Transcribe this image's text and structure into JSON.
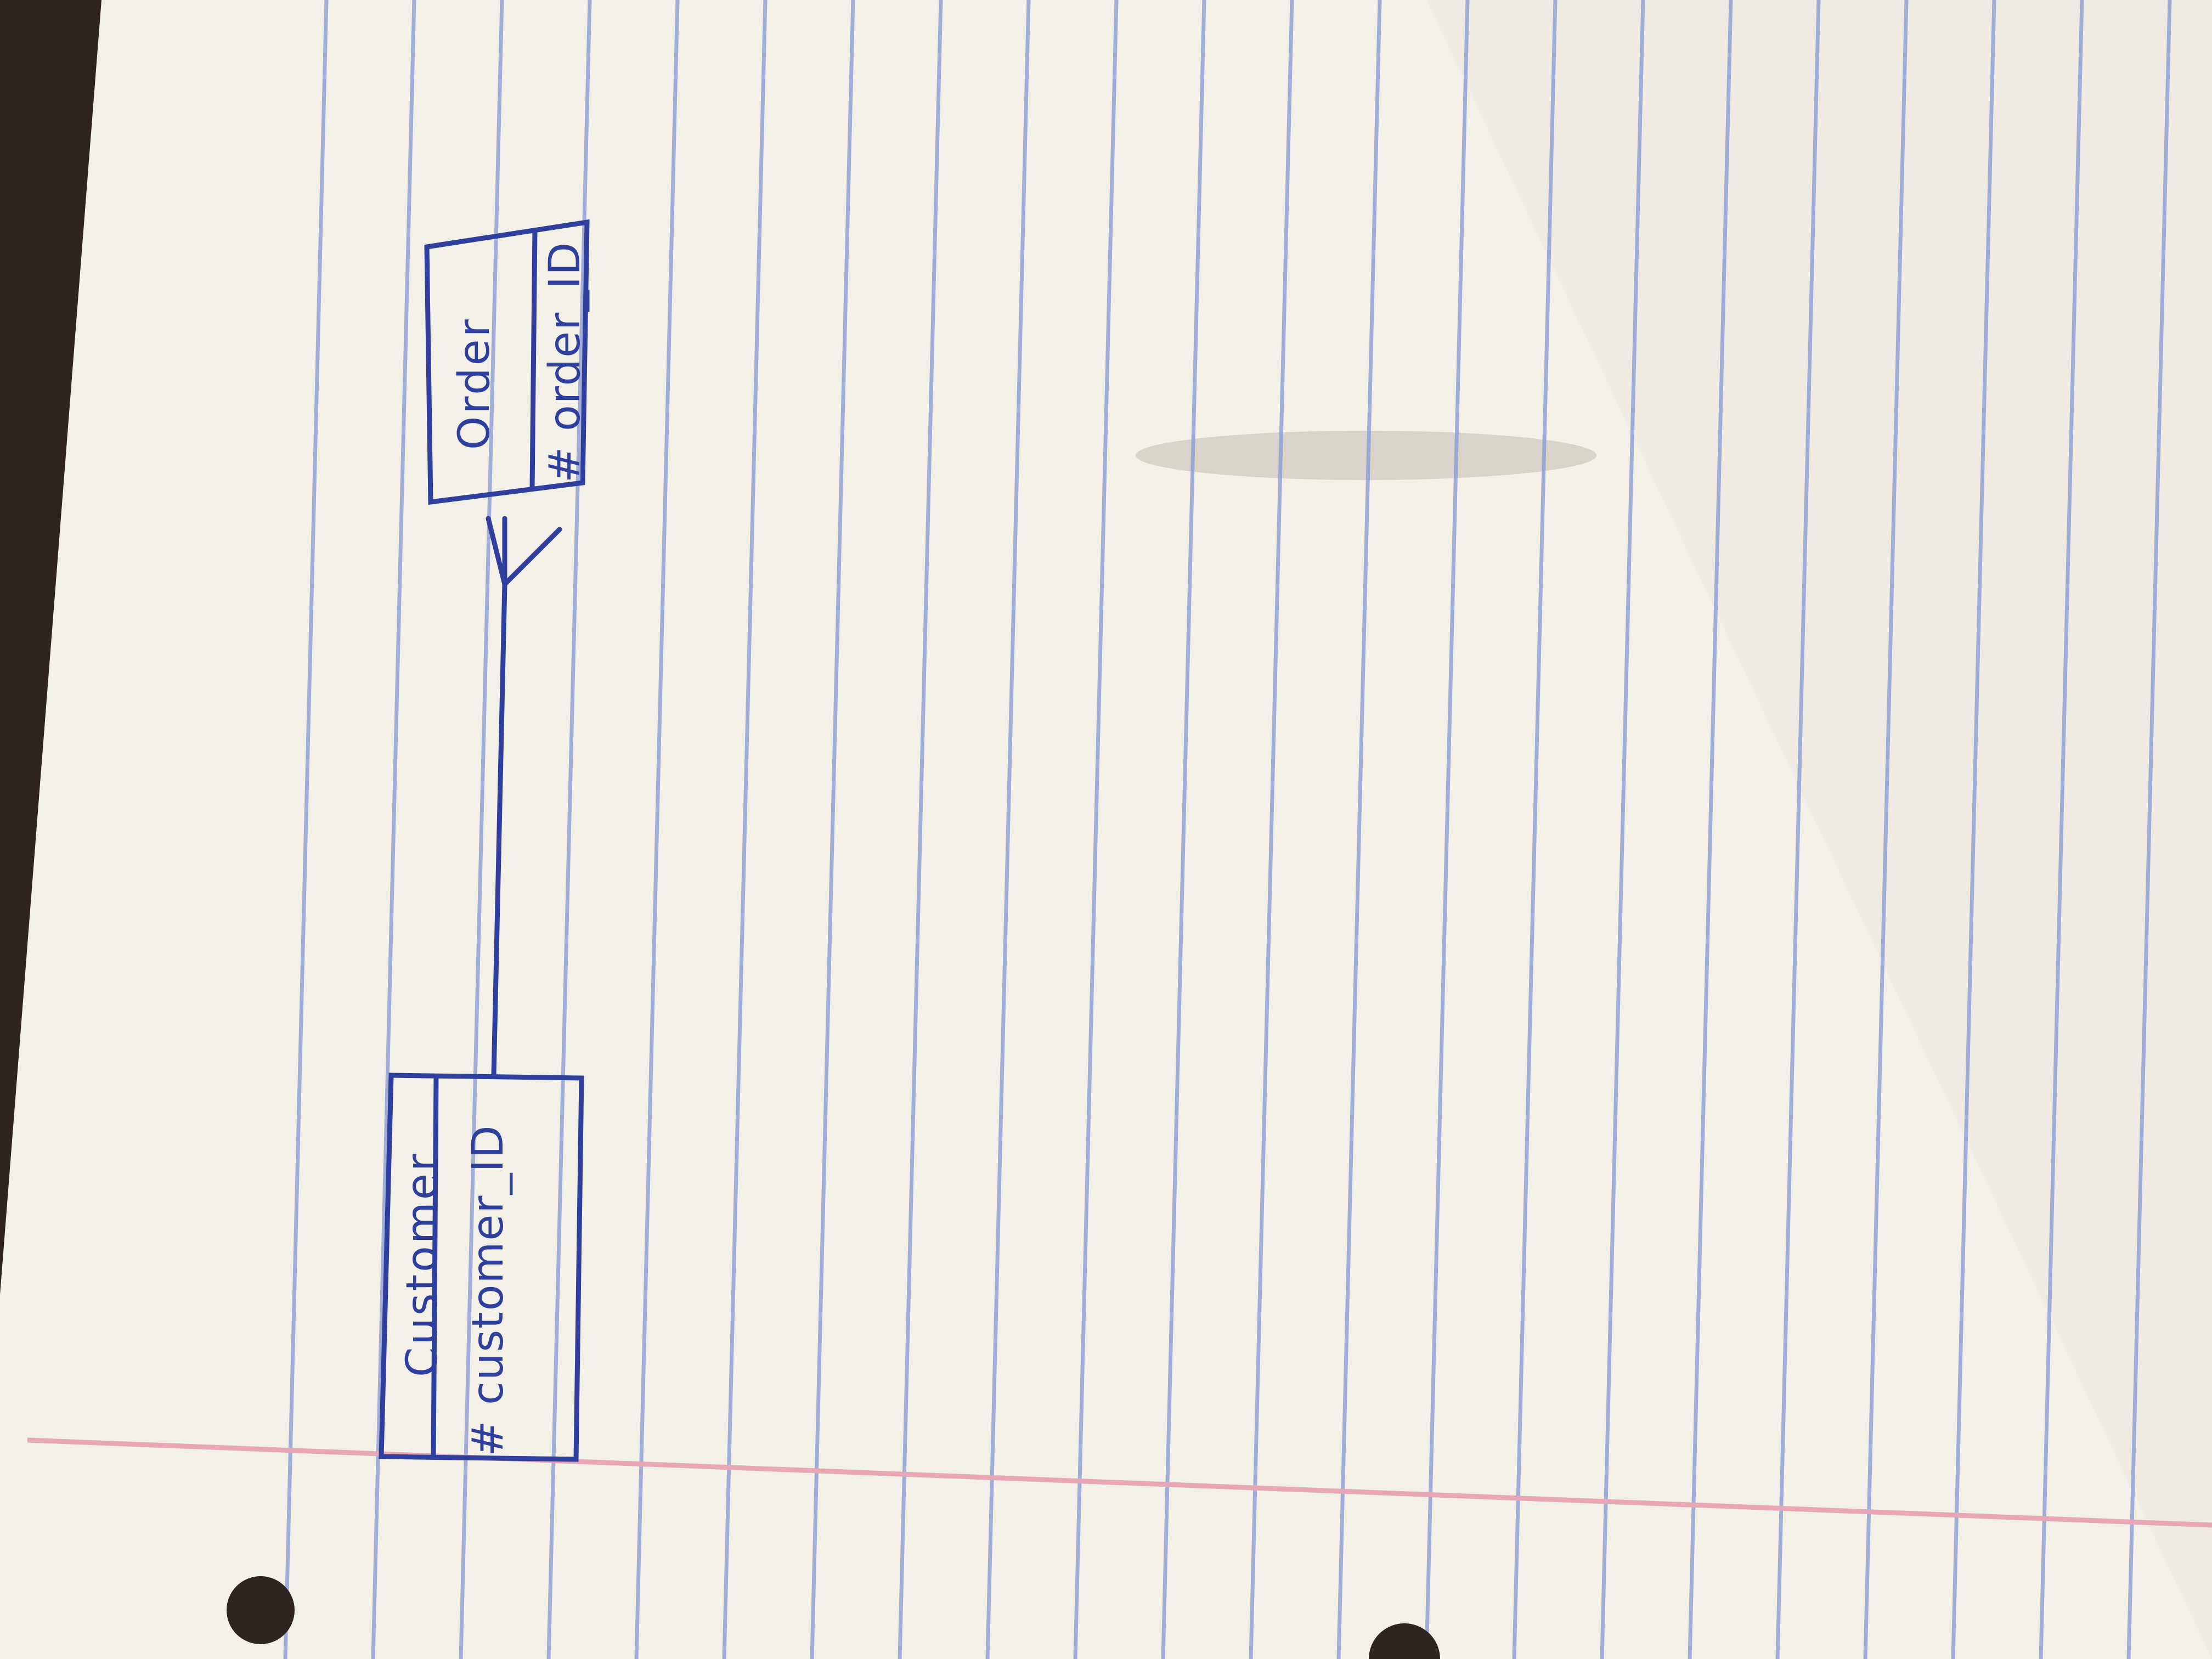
{
  "colors": {
    "paper": "#f3f0e8",
    "desk": "#2e2420",
    "rule_line": "#8e9ed4",
    "margin_line": "#e7a7b4",
    "ink": "#2f3f9e"
  },
  "diagram": {
    "entities": [
      {
        "id": "customer",
        "name": "Customer",
        "attribute": "# customer_ID"
      },
      {
        "id": "order",
        "name": "Order",
        "attribute": "# order_ID"
      }
    ],
    "relationships": [
      {
        "from": "customer",
        "to": "order",
        "from_cardinality": "one",
        "to_cardinality": "many"
      }
    ]
  }
}
